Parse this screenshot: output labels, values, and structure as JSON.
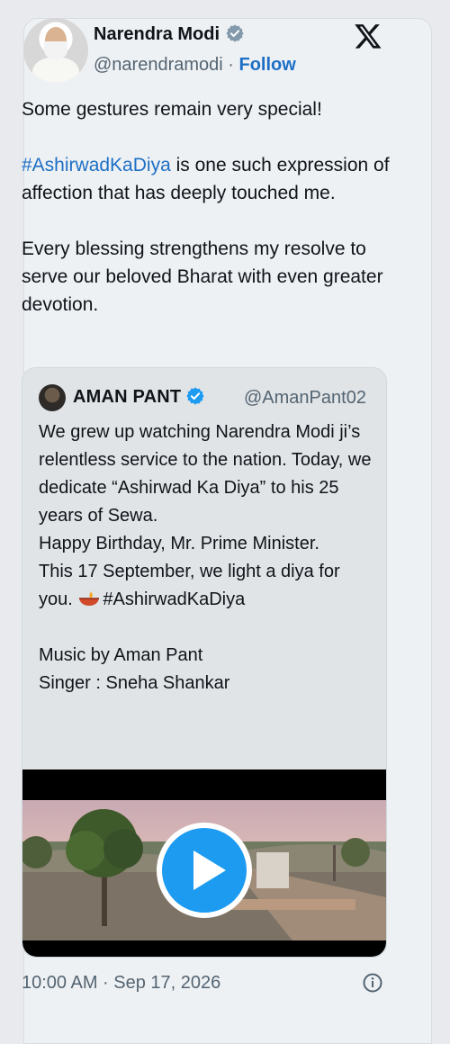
{
  "author": {
    "name": "Narendra Modi",
    "handle": "@narendramodi",
    "separator": " · ",
    "follow_label": "Follow"
  },
  "post": {
    "line1": "Some gestures remain very special!",
    "hashtag": "#AshirwadKaDiya",
    "line2_rest": " is one such expression of affection that has deeply touched me.",
    "line3": "Every blessing strengthens my resolve to serve our beloved Bharat with even greater devotion."
  },
  "quoted": {
    "name": "AMAN PANT",
    "handle": "@AmanPant02",
    "para1": "We grew up watching Narendra Modi ji’s relentless service to the nation. Today, we dedicate “Ashirwad Ka Diya” to his 25 years of Sewa.",
    "para2": "Happy Birthday, Mr. Prime Minister.",
    "para3_prefix": "This 17 September, we light a diya for you. ",
    "para3_hashtag": "#AshirwadKaDiya",
    "music": "Music by Aman Pant",
    "singer": "Singer : Sneha Shankar"
  },
  "footer": {
    "timestamp": "10:00 AM · Sep 17, 2026"
  },
  "icons": {
    "verified": "verified-badge-icon",
    "x_logo": "x-logo-icon",
    "play": "play-icon",
    "info": "info-icon",
    "diya": "diya-emoji-icon"
  },
  "colors": {
    "link": "#1d6fc5",
    "verified": "#1d9bf0",
    "muted": "#536471"
  }
}
